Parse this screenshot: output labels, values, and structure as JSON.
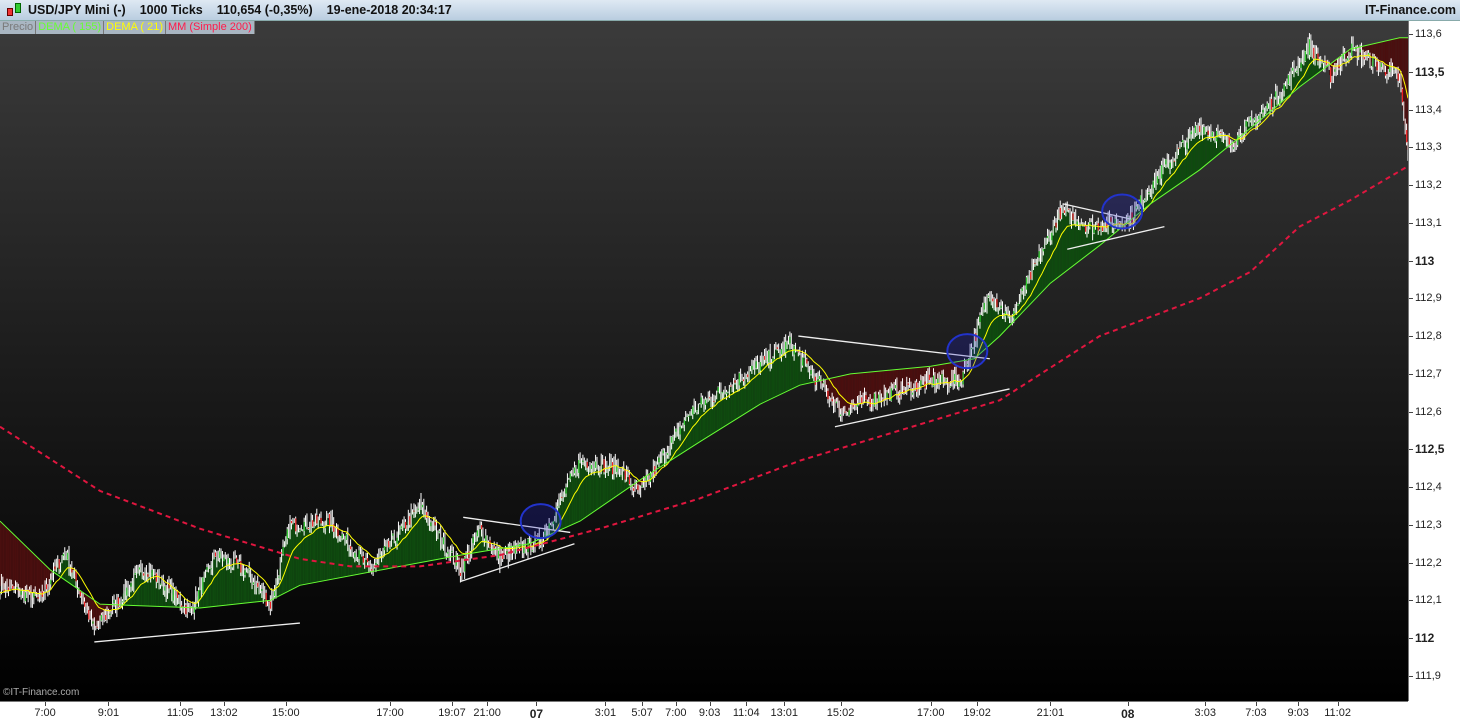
{
  "titlebar": {
    "instrument": "USD/JPY Mini (-)",
    "period": "1000 Ticks",
    "last": "110,654 (-0,35%)",
    "datetime": "19-ene-2018 20:34:17",
    "brand": "IT-Finance.com",
    "icon": "candlestick-icon"
  },
  "legend": [
    {
      "label": "Precio",
      "color": "#7a7a7a"
    },
    {
      "label": "DEMA ( 155)",
      "color": "#66ff33"
    },
    {
      "label": "DEMA ( 21)",
      "color": "#ffff00"
    },
    {
      "label": "MM (Simple 200)",
      "color": "#ff1a4a"
    }
  ],
  "watermark": "©IT-Finance.com",
  "chart_data": {
    "type": "line",
    "ylim": [
      111.9,
      113.6
    ],
    "y_ticks": [
      "113,6",
      "113,5",
      "113,4",
      "113,3",
      "113,2",
      "113,1",
      "113",
      "112,9",
      "112,8",
      "112,7",
      "112,6",
      "112,5",
      "112,4",
      "112,3",
      "112,2",
      "112,1",
      "112",
      "111,9"
    ],
    "y_bold": [
      "113,5",
      "113",
      "112,5",
      "112"
    ],
    "x_ticks": [
      {
        "label": "7:00",
        "bar": 32
      },
      {
        "label": "9:01",
        "bar": 77
      },
      {
        "label": "11:05",
        "bar": 128
      },
      {
        "label": "13:02",
        "bar": 159
      },
      {
        "label": "15:00",
        "bar": 203
      },
      {
        "label": "17:00",
        "bar": 277
      },
      {
        "label": "19:07",
        "bar": 321
      },
      {
        "label": "21:00",
        "bar": 346
      },
      {
        "label": "07",
        "bar": 381,
        "bold": true
      },
      {
        "label": "3:01",
        "bar": 430
      },
      {
        "label": "5:07",
        "bar": 456
      },
      {
        "label": "7:00",
        "bar": 480
      },
      {
        "label": "9:03",
        "bar": 504
      },
      {
        "label": "11:04",
        "bar": 530
      },
      {
        "label": "13:01",
        "bar": 557
      },
      {
        "label": "15:02",
        "bar": 597
      },
      {
        "label": "17:00",
        "bar": 661
      },
      {
        "label": "19:02",
        "bar": 694
      },
      {
        "label": "21:01",
        "bar": 746
      },
      {
        "label": "08",
        "bar": 801,
        "bold": true
      },
      {
        "label": "3:03",
        "bar": 856
      },
      {
        "label": "7:03",
        "bar": 892
      },
      {
        "label": "9:03",
        "bar": 922
      },
      {
        "label": "11:02",
        "bar": 950
      }
    ],
    "xlim": [
      0,
      1000
    ],
    "series": [
      {
        "name": "Precio",
        "color": "#ffffff",
        "points": [
          [
            0,
            112.14
          ],
          [
            28,
            112.1
          ],
          [
            46,
            112.23
          ],
          [
            67,
            112.02
          ],
          [
            103,
            112.19
          ],
          [
            135,
            112.07
          ],
          [
            153,
            112.22
          ],
          [
            174,
            112.18
          ],
          [
            192,
            112.09
          ],
          [
            206,
            112.3
          ],
          [
            234,
            112.31
          ],
          [
            263,
            112.18
          ],
          [
            298,
            112.35
          ],
          [
            327,
            112.18
          ],
          [
            341,
            112.29
          ],
          [
            355,
            112.21
          ],
          [
            384,
            112.26
          ],
          [
            412,
            112.47
          ],
          [
            440,
            112.45
          ],
          [
            454,
            112.38
          ],
          [
            490,
            112.6
          ],
          [
            518,
            112.67
          ],
          [
            561,
            112.78
          ],
          [
            589,
            112.64
          ],
          [
            597,
            112.6
          ],
          [
            625,
            112.64
          ],
          [
            661,
            112.68
          ],
          [
            682,
            112.68
          ],
          [
            703,
            112.92
          ],
          [
            717,
            112.84
          ],
          [
            753,
            113.13
          ],
          [
            774,
            113.09
          ],
          [
            803,
            113.11
          ],
          [
            817,
            113.2
          ],
          [
            852,
            113.36
          ],
          [
            874,
            113.31
          ],
          [
            909,
            113.44
          ],
          [
            930,
            113.57
          ],
          [
            945,
            113.49
          ],
          [
            959,
            113.56
          ],
          [
            987,
            113.5
          ],
          [
            994,
            113.48
          ],
          [
            1000,
            113.27
          ]
        ]
      },
      {
        "name": "DEMA ( 155)",
        "color": "#66ff33",
        "points": [
          [
            0,
            112.31
          ],
          [
            36,
            112.18
          ],
          [
            71,
            112.09
          ],
          [
            142,
            112.08
          ],
          [
            192,
            112.1
          ],
          [
            213,
            112.14
          ],
          [
            284,
            112.19
          ],
          [
            327,
            112.22
          ],
          [
            376,
            112.25
          ],
          [
            412,
            112.31
          ],
          [
            455,
            112.42
          ],
          [
            497,
            112.52
          ],
          [
            540,
            112.62
          ],
          [
            568,
            112.67
          ],
          [
            604,
            112.7
          ],
          [
            661,
            112.72
          ],
          [
            692,
            112.74
          ],
          [
            710,
            112.8
          ],
          [
            746,
            112.94
          ],
          [
            781,
            113.04
          ],
          [
            817,
            113.15
          ],
          [
            852,
            113.24
          ],
          [
            888,
            113.35
          ],
          [
            923,
            113.46
          ],
          [
            959,
            113.56
          ],
          [
            994,
            113.59
          ],
          [
            1000,
            113.59
          ]
        ]
      },
      {
        "name": "MM (Simple 200)",
        "color": "#ff1a4a",
        "dashed": true,
        "points": [
          [
            0,
            112.56
          ],
          [
            71,
            112.39
          ],
          [
            142,
            112.29
          ],
          [
            213,
            112.21
          ],
          [
            249,
            112.19
          ],
          [
            298,
            112.19
          ],
          [
            355,
            112.22
          ],
          [
            426,
            112.29
          ],
          [
            497,
            112.37
          ],
          [
            568,
            112.47
          ],
          [
            639,
            112.55
          ],
          [
            710,
            112.63
          ],
          [
            781,
            112.8
          ],
          [
            852,
            112.9
          ],
          [
            888,
            112.97
          ],
          [
            923,
            113.09
          ],
          [
            959,
            113.16
          ],
          [
            1000,
            113.25
          ]
        ]
      }
    ],
    "trendlines": [
      [
        [
          67,
          111.99
        ],
        [
          213,
          112.04
        ]
      ],
      [
        [
          327,
          112.15
        ],
        [
          408,
          112.25
        ]
      ],
      [
        [
          329,
          112.32
        ],
        [
          405,
          112.28
        ]
      ],
      [
        [
          593,
          112.56
        ],
        [
          717,
          112.66
        ]
      ],
      [
        [
          567,
          112.8
        ],
        [
          703,
          112.74
        ]
      ],
      [
        [
          758,
          113.03
        ],
        [
          827,
          113.09
        ]
      ],
      [
        [
          755,
          113.15
        ],
        [
          803,
          113.11
        ]
      ]
    ],
    "circles": [
      [
        384,
        112.31
      ],
      [
        687,
        112.76
      ],
      [
        797,
        113.13
      ]
    ]
  }
}
